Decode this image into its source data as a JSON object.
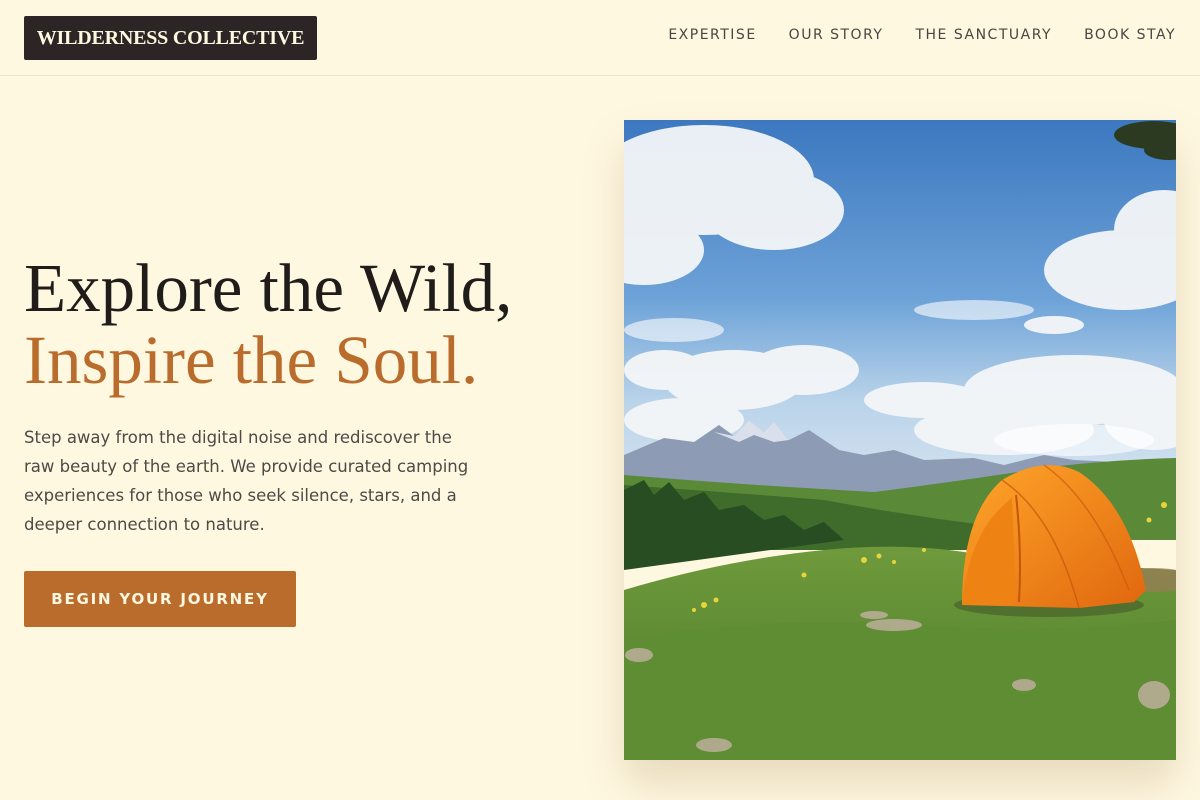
{
  "brand": {
    "name": "WILDERNESS COLLECTIVE"
  },
  "nav": {
    "items": [
      {
        "label": "EXPERTISE"
      },
      {
        "label": "OUR STORY"
      },
      {
        "label": "THE SANCTUARY"
      },
      {
        "label": "BOOK STAY"
      }
    ]
  },
  "hero": {
    "title_line1": "Explore the Wild,",
    "title_line2": "Inspire the Soul.",
    "description": "Step away from the digital noise and rediscover the raw beauty of the earth. We provide curated camping experiences for those who seek silence, stars, and a deeper connection to nature.",
    "cta_label": "BEGIN YOUR JOURNEY"
  },
  "colors": {
    "background": "#fff8e1",
    "brand_dark": "#2b2625",
    "accent": "#b96c2c"
  }
}
